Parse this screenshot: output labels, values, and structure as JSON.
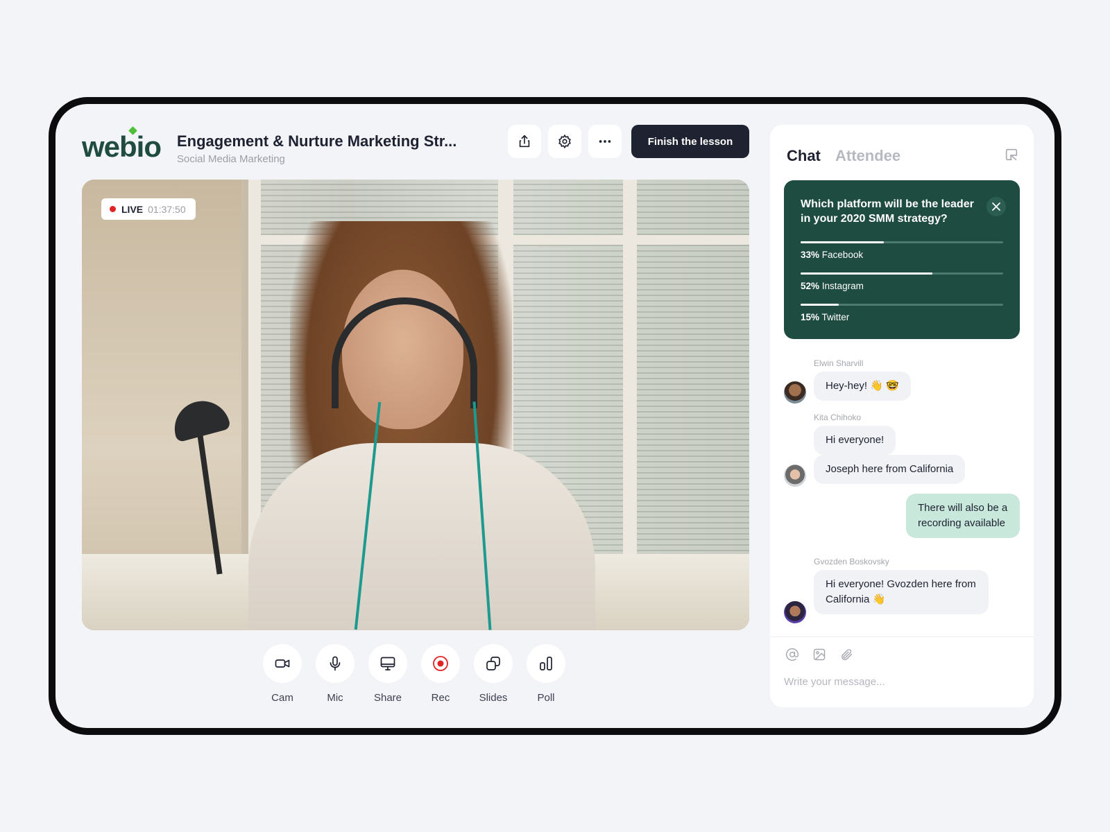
{
  "brand": {
    "logo": "webio",
    "logo_color": "#1f4c3e",
    "dot_color": "#4fbf3a"
  },
  "header": {
    "title": "Engagement & Nurture Marketing Str...",
    "subtitle": "Social Media Marketing",
    "icons": [
      "share-icon",
      "settings-icon",
      "more-icon"
    ],
    "finish_label": "Finish the lesson"
  },
  "video": {
    "live_label": "LIVE",
    "timer": "01:37:50"
  },
  "controls": [
    {
      "label": "Cam",
      "icon": "camera-icon"
    },
    {
      "label": "Mic",
      "icon": "mic-icon"
    },
    {
      "label": "Share",
      "icon": "screen-share-icon"
    },
    {
      "label": "Rec",
      "icon": "record-icon"
    },
    {
      "label": "Slides",
      "icon": "slides-icon"
    },
    {
      "label": "Poll",
      "icon": "poll-icon"
    }
  ],
  "sidebar": {
    "tabs": [
      {
        "label": "Chat",
        "active": true
      },
      {
        "label": "Attendee",
        "active": false
      }
    ],
    "poll": {
      "question": "Which platform will be the leader in your 2020 SMM strategy?",
      "options": [
        {
          "percent_label": "33%",
          "name": "Facebook",
          "value": 33
        },
        {
          "percent_label": "52%",
          "name": "Instagram",
          "value": 52
        },
        {
          "percent_label": "15%",
          "name": "Twitter",
          "value": 15
        }
      ]
    },
    "messages": [
      {
        "author": "Elwin Sharvill",
        "text": "Hey-hey! 👋 🤓"
      },
      {
        "author": "Kita Chihoko",
        "text": "Hi everyone!"
      },
      {
        "author": "",
        "text": "Joseph here from California"
      },
      {
        "author": "",
        "text": "There will also be a recording available",
        "own": true
      },
      {
        "author": "Gvozden Boskovsky",
        "text": "Hi everyone! Gvozden here from California 👋"
      }
    ],
    "composer": {
      "placeholder": "Write your message...",
      "icons": [
        "mention-icon",
        "image-icon",
        "attach-icon"
      ]
    }
  },
  "colors": {
    "accent_dark": "#1f4c40",
    "own_bubble": "#c9e8dc",
    "live_red": "#e02424",
    "primary_button": "#1f2230"
  }
}
